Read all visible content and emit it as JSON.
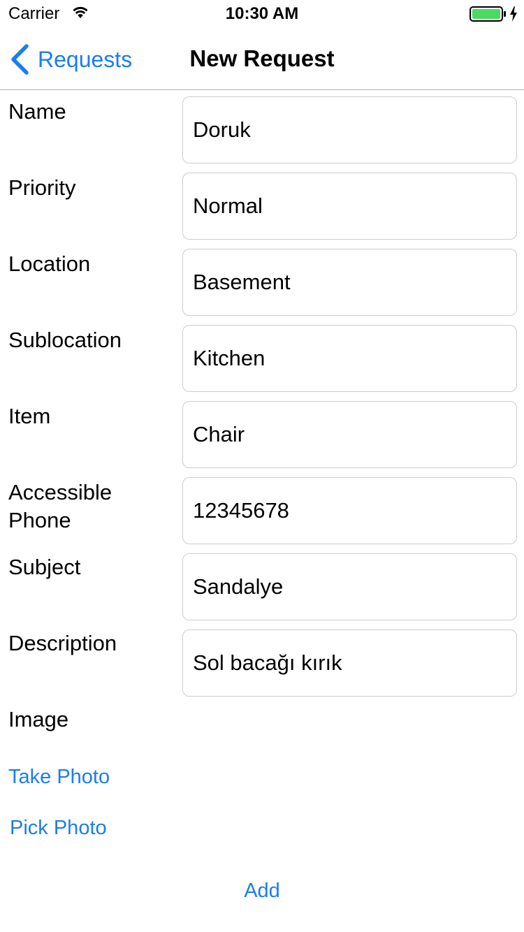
{
  "status_bar": {
    "carrier": "Carrier",
    "time": "10:30 AM",
    "battery_color": "#4cd964"
  },
  "nav": {
    "back_label": "Requests",
    "title": "New Request",
    "tint_color": "#1a7cf4"
  },
  "form": {
    "fields": [
      {
        "label": "Name",
        "value": "Doruk"
      },
      {
        "label": "Priority",
        "value": "Normal"
      },
      {
        "label": "Location",
        "value": "Basement"
      },
      {
        "label": "Sublocation",
        "value": "Kitchen"
      },
      {
        "label": "Item",
        "value": "Chair"
      },
      {
        "label": "Accessible Phone",
        "value": "12345678"
      },
      {
        "label": "Subject",
        "value": "Sandalye"
      },
      {
        "label": "Description",
        "value": "Sol bacağı kırık"
      }
    ],
    "image_label": "Image",
    "take_photo_label": "Take Photo",
    "pick_photo_label": "Pick Photo",
    "add_label": "Add"
  }
}
